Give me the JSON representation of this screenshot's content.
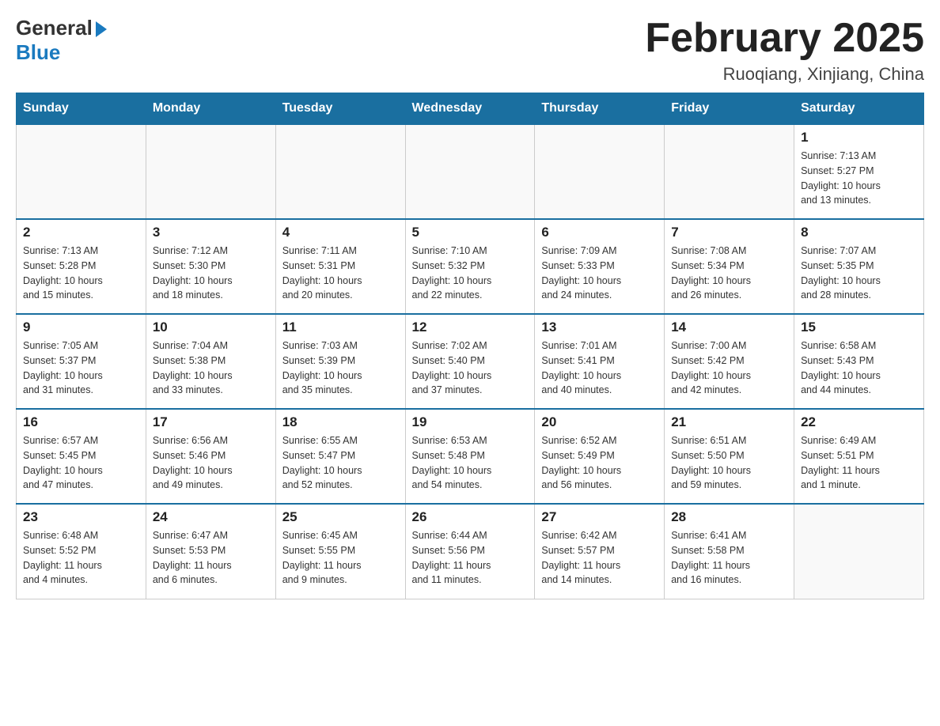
{
  "header": {
    "logo_general": "General",
    "logo_blue": "Blue",
    "month_title": "February 2025",
    "location": "Ruoqiang, Xinjiang, China"
  },
  "weekdays": [
    "Sunday",
    "Monday",
    "Tuesday",
    "Wednesday",
    "Thursday",
    "Friday",
    "Saturday"
  ],
  "weeks": [
    [
      {
        "day": "",
        "info": ""
      },
      {
        "day": "",
        "info": ""
      },
      {
        "day": "",
        "info": ""
      },
      {
        "day": "",
        "info": ""
      },
      {
        "day": "",
        "info": ""
      },
      {
        "day": "",
        "info": ""
      },
      {
        "day": "1",
        "info": "Sunrise: 7:13 AM\nSunset: 5:27 PM\nDaylight: 10 hours\nand 13 minutes."
      }
    ],
    [
      {
        "day": "2",
        "info": "Sunrise: 7:13 AM\nSunset: 5:28 PM\nDaylight: 10 hours\nand 15 minutes."
      },
      {
        "day": "3",
        "info": "Sunrise: 7:12 AM\nSunset: 5:30 PM\nDaylight: 10 hours\nand 18 minutes."
      },
      {
        "day": "4",
        "info": "Sunrise: 7:11 AM\nSunset: 5:31 PM\nDaylight: 10 hours\nand 20 minutes."
      },
      {
        "day": "5",
        "info": "Sunrise: 7:10 AM\nSunset: 5:32 PM\nDaylight: 10 hours\nand 22 minutes."
      },
      {
        "day": "6",
        "info": "Sunrise: 7:09 AM\nSunset: 5:33 PM\nDaylight: 10 hours\nand 24 minutes."
      },
      {
        "day": "7",
        "info": "Sunrise: 7:08 AM\nSunset: 5:34 PM\nDaylight: 10 hours\nand 26 minutes."
      },
      {
        "day": "8",
        "info": "Sunrise: 7:07 AM\nSunset: 5:35 PM\nDaylight: 10 hours\nand 28 minutes."
      }
    ],
    [
      {
        "day": "9",
        "info": "Sunrise: 7:05 AM\nSunset: 5:37 PM\nDaylight: 10 hours\nand 31 minutes."
      },
      {
        "day": "10",
        "info": "Sunrise: 7:04 AM\nSunset: 5:38 PM\nDaylight: 10 hours\nand 33 minutes."
      },
      {
        "day": "11",
        "info": "Sunrise: 7:03 AM\nSunset: 5:39 PM\nDaylight: 10 hours\nand 35 minutes."
      },
      {
        "day": "12",
        "info": "Sunrise: 7:02 AM\nSunset: 5:40 PM\nDaylight: 10 hours\nand 37 minutes."
      },
      {
        "day": "13",
        "info": "Sunrise: 7:01 AM\nSunset: 5:41 PM\nDaylight: 10 hours\nand 40 minutes."
      },
      {
        "day": "14",
        "info": "Sunrise: 7:00 AM\nSunset: 5:42 PM\nDaylight: 10 hours\nand 42 minutes."
      },
      {
        "day": "15",
        "info": "Sunrise: 6:58 AM\nSunset: 5:43 PM\nDaylight: 10 hours\nand 44 minutes."
      }
    ],
    [
      {
        "day": "16",
        "info": "Sunrise: 6:57 AM\nSunset: 5:45 PM\nDaylight: 10 hours\nand 47 minutes."
      },
      {
        "day": "17",
        "info": "Sunrise: 6:56 AM\nSunset: 5:46 PM\nDaylight: 10 hours\nand 49 minutes."
      },
      {
        "day": "18",
        "info": "Sunrise: 6:55 AM\nSunset: 5:47 PM\nDaylight: 10 hours\nand 52 minutes."
      },
      {
        "day": "19",
        "info": "Sunrise: 6:53 AM\nSunset: 5:48 PM\nDaylight: 10 hours\nand 54 minutes."
      },
      {
        "day": "20",
        "info": "Sunrise: 6:52 AM\nSunset: 5:49 PM\nDaylight: 10 hours\nand 56 minutes."
      },
      {
        "day": "21",
        "info": "Sunrise: 6:51 AM\nSunset: 5:50 PM\nDaylight: 10 hours\nand 59 minutes."
      },
      {
        "day": "22",
        "info": "Sunrise: 6:49 AM\nSunset: 5:51 PM\nDaylight: 11 hours\nand 1 minute."
      }
    ],
    [
      {
        "day": "23",
        "info": "Sunrise: 6:48 AM\nSunset: 5:52 PM\nDaylight: 11 hours\nand 4 minutes."
      },
      {
        "day": "24",
        "info": "Sunrise: 6:47 AM\nSunset: 5:53 PM\nDaylight: 11 hours\nand 6 minutes."
      },
      {
        "day": "25",
        "info": "Sunrise: 6:45 AM\nSunset: 5:55 PM\nDaylight: 11 hours\nand 9 minutes."
      },
      {
        "day": "26",
        "info": "Sunrise: 6:44 AM\nSunset: 5:56 PM\nDaylight: 11 hours\nand 11 minutes."
      },
      {
        "day": "27",
        "info": "Sunrise: 6:42 AM\nSunset: 5:57 PM\nDaylight: 11 hours\nand 14 minutes."
      },
      {
        "day": "28",
        "info": "Sunrise: 6:41 AM\nSunset: 5:58 PM\nDaylight: 11 hours\nand 16 minutes."
      },
      {
        "day": "",
        "info": ""
      }
    ]
  ]
}
